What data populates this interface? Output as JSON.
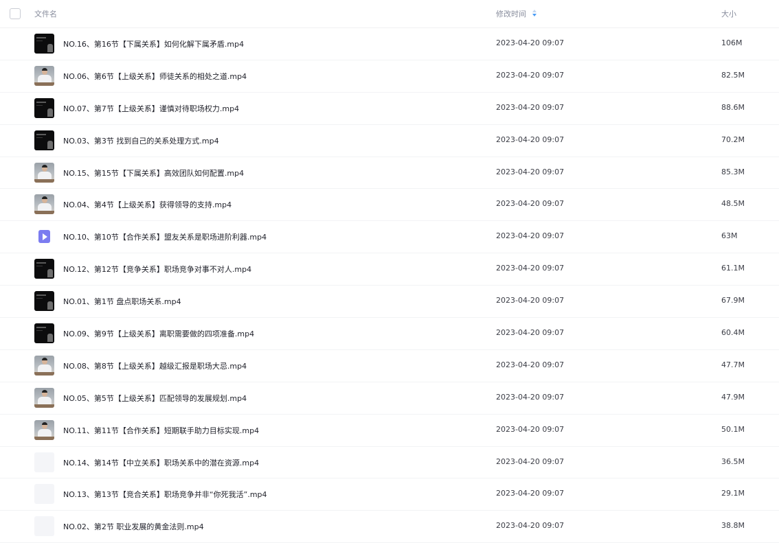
{
  "header": {
    "name_label": "文件名",
    "time_label": "修改时间",
    "size_label": "大小"
  },
  "colors": {
    "sort_active": "#4a9cf5",
    "sort_inactive": "#c3d6f0",
    "video_icon": "#7b7cf0"
  },
  "files": [
    {
      "name": "NO.16、第16节【下属关系】如何化解下属矛盾.mp4",
      "time": "2023-04-20 09:07",
      "size": "106M",
      "thumb": "dark"
    },
    {
      "name": "NO.06、第6节【上级关系】师徒关系的相处之道.mp4",
      "time": "2023-04-20 09:07",
      "size": "82.5M",
      "thumb": "person"
    },
    {
      "name": "NO.07、第7节【上级关系】谨慎对待职场权力.mp4",
      "time": "2023-04-20 09:07",
      "size": "88.6M",
      "thumb": "dark"
    },
    {
      "name": "NO.03、第3节 找到自己的关系处理方式.mp4",
      "time": "2023-04-20 09:07",
      "size": "70.2M",
      "thumb": "dark"
    },
    {
      "name": "NO.15、第15节【下属关系】高效团队如何配置.mp4",
      "time": "2023-04-20 09:07",
      "size": "85.3M",
      "thumb": "person"
    },
    {
      "name": "NO.04、第4节【上级关系】获得领导的支持.mp4",
      "time": "2023-04-20 09:07",
      "size": "48.5M",
      "thumb": "person"
    },
    {
      "name": "NO.10、第10节【合作关系】盟友关系是职场进阶利器.mp4",
      "time": "2023-04-20 09:07",
      "size": "63M",
      "thumb": "video"
    },
    {
      "name": "NO.12、第12节【竞争关系】职场竞争对事不对人.mp4",
      "time": "2023-04-20 09:07",
      "size": "61.1M",
      "thumb": "dark"
    },
    {
      "name": "NO.01、第1节 盘点职场关系.mp4",
      "time": "2023-04-20 09:07",
      "size": "67.9M",
      "thumb": "dark"
    },
    {
      "name": "NO.09、第9节【上级关系】离职需要做的四项准备.mp4",
      "time": "2023-04-20 09:07",
      "size": "60.4M",
      "thumb": "dark"
    },
    {
      "name": "NO.08、第8节【上级关系】越级汇报是职场大忌.mp4",
      "time": "2023-04-20 09:07",
      "size": "47.7M",
      "thumb": "person"
    },
    {
      "name": "NO.05、第5节【上级关系】匹配领导的发展规划.mp4",
      "time": "2023-04-20 09:07",
      "size": "47.9M",
      "thumb": "person"
    },
    {
      "name": "NO.11、第11节【合作关系】短期联手助力目标实现.mp4",
      "time": "2023-04-20 09:07",
      "size": "50.1M",
      "thumb": "person"
    },
    {
      "name": "NO.14、第14节【中立关系】职场关系中的潜在资源.mp4",
      "time": "2023-04-20 09:07",
      "size": "36.5M",
      "thumb": "blank"
    },
    {
      "name": "NO.13、第13节【竞合关系】职场竞争并非“你死我活”.mp4",
      "time": "2023-04-20 09:07",
      "size": "29.1M",
      "thumb": "blank"
    },
    {
      "name": "NO.02、第2节 职业发展的黄金法则.mp4",
      "time": "2023-04-20 09:07",
      "size": "38.8M",
      "thumb": "blank"
    }
  ]
}
